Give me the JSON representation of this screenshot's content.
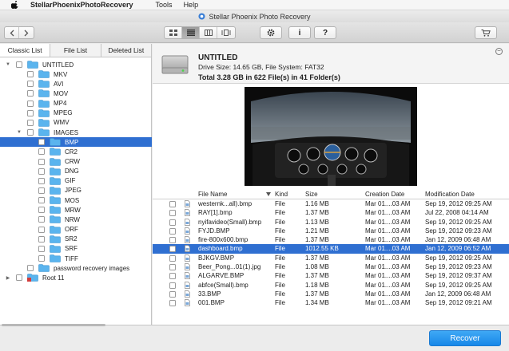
{
  "menubar": {
    "app_name": "StellarPhoenixPhotoRecovery",
    "menus": [
      "Tools",
      "Help"
    ]
  },
  "window": {
    "title": "Stellar Phoenix Photo Recovery"
  },
  "toolbar": {
    "view_modes": [
      "icon-view-icon",
      "list-view-icon",
      "column-view-icon",
      "coverflow-view-icon"
    ],
    "active_view": "list-view-icon",
    "buttons": [
      "gear-icon",
      "info-icon",
      "help-icon",
      "cart-icon"
    ],
    "info_label": "i",
    "help_label": "?"
  },
  "tabs": [
    "Classic List",
    "File List",
    "Deleted List"
  ],
  "tree": [
    {
      "label": "UNTITLED",
      "level": 0,
      "expanded": true,
      "type": "drive"
    },
    {
      "label": "MKV",
      "level": 1
    },
    {
      "label": "AVI",
      "level": 1
    },
    {
      "label": "MOV",
      "level": 1
    },
    {
      "label": "MP4",
      "level": 1
    },
    {
      "label": "MPEG",
      "level": 1
    },
    {
      "label": "WMV",
      "level": 1
    },
    {
      "label": "IMAGES",
      "level": 1,
      "expanded": true
    },
    {
      "label": "BMP",
      "level": 2,
      "selected": true
    },
    {
      "label": "CR2",
      "level": 2
    },
    {
      "label": "CRW",
      "level": 2
    },
    {
      "label": "DNG",
      "level": 2
    },
    {
      "label": "GIF",
      "level": 2
    },
    {
      "label": "JPEG",
      "level": 2
    },
    {
      "label": "MOS",
      "level": 2
    },
    {
      "label": "MRW",
      "level": 2
    },
    {
      "label": "NRW",
      "level": 2
    },
    {
      "label": "ORF",
      "level": 2
    },
    {
      "label": "SR2",
      "level": 2
    },
    {
      "label": "SRF",
      "level": 2
    },
    {
      "label": "TIFF",
      "level": 2
    },
    {
      "label": "password recovery images",
      "level": 1
    },
    {
      "label": "Root 11",
      "level": 0,
      "collapsed": true,
      "type": "root"
    }
  ],
  "drive": {
    "title": "UNTITLED",
    "info": "Drive Size: 14.65 GB, File System: FAT32",
    "total": "Total 3.28 GB in 622 File(s) in 41 Folder(s)"
  },
  "file_table": {
    "columns": [
      "File Name",
      "Kind",
      "Size",
      "Creation Date",
      "Modification Date"
    ],
    "rows": [
      {
        "name": "westernk...all).bmp",
        "kind": "File",
        "size": "1.16 MB",
        "created": "Mar 01....03 AM",
        "modified": "Sep 19, 2012 09:25 AM"
      },
      {
        "name": "RAY[1].bmp",
        "kind": "File",
        "size": "1.37 MB",
        "created": "Mar 01....03 AM",
        "modified": "Jul 22, 2008 04:14 AM"
      },
      {
        "name": "nyifavideo(Small).bmp",
        "kind": "File",
        "size": "1.13 MB",
        "created": "Mar 01....03 AM",
        "modified": "Sep 19, 2012 09:25 AM"
      },
      {
        "name": "FYJD.BMP",
        "kind": "File",
        "size": "1.21 MB",
        "created": "Mar 01....03 AM",
        "modified": "Sep 19, 2012 09:23 AM"
      },
      {
        "name": "fire-800x600.bmp",
        "kind": "File",
        "size": "1.37 MB",
        "created": "Mar 01....03 AM",
        "modified": "Jan 12, 2009 06:48 AM"
      },
      {
        "name": "dashboard.bmp",
        "kind": "File",
        "size": "1012.55 KB",
        "created": "Mar 01....03 AM",
        "modified": "Jan 12, 2009 06:52 AM",
        "selected": true
      },
      {
        "name": "BJKGV.BMP",
        "kind": "File",
        "size": "1.37 MB",
        "created": "Mar 01....03 AM",
        "modified": "Sep 19, 2012 09:25 AM"
      },
      {
        "name": "Beer_Pong...01(1).jpg",
        "kind": "File",
        "size": "1.08 MB",
        "created": "Mar 01....03 AM",
        "modified": "Sep 19, 2012 09:23 AM"
      },
      {
        "name": "ALGARVE.BMP",
        "kind": "File",
        "size": "1.37 MB",
        "created": "Mar 01....03 AM",
        "modified": "Sep 19, 2012 09:37 AM"
      },
      {
        "name": "abfce(Small).bmp",
        "kind": "File",
        "size": "1.18 MB",
        "created": "Mar 01....03 AM",
        "modified": "Sep 19, 2012 09:25 AM"
      },
      {
        "name": "33.BMP",
        "kind": "File",
        "size": "1.37 MB",
        "created": "Mar 01....03 AM",
        "modified": "Jan 12, 2009 06:48 AM"
      },
      {
        "name": "001.BMP",
        "kind": "File",
        "size": "1.34 MB",
        "created": "Mar 01....03 AM",
        "modified": "Sep 19, 2012 09:21 AM"
      }
    ]
  },
  "recover_label": "Recover",
  "colors": {
    "selection": "#2f6fd1",
    "folder": "#5ab4ee",
    "recover_button": "#2196f3"
  }
}
